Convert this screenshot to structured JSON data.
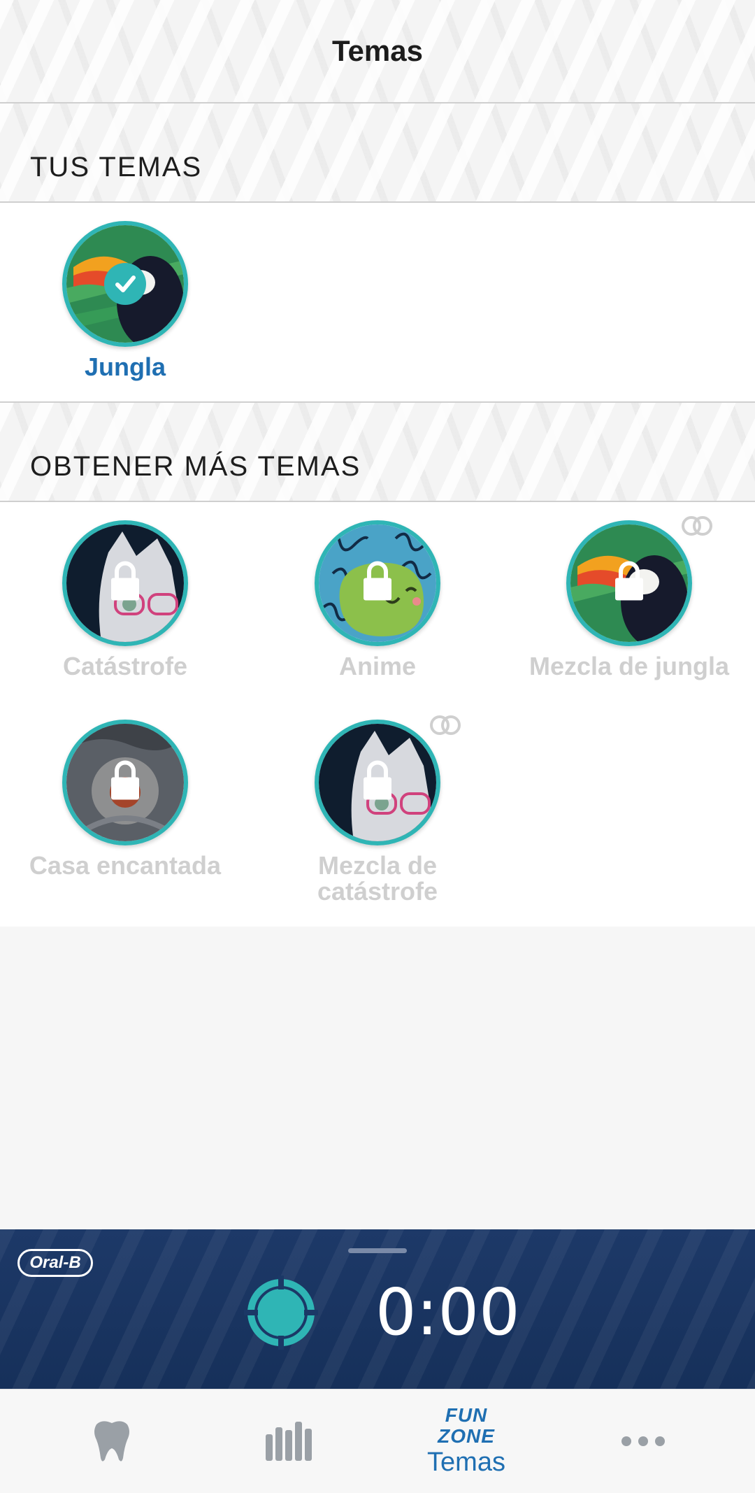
{
  "header": {
    "title": "Temas"
  },
  "your_themes": {
    "heading": "TUS TEMAS",
    "items": [
      {
        "name": "Jungla",
        "selected": true,
        "icon": "toucan-image"
      }
    ]
  },
  "more_themes": {
    "heading": "OBTENER MÁS TEMAS",
    "items": [
      {
        "name": "Catástrofe",
        "locked": true,
        "icon": "cat-image"
      },
      {
        "name": "Anime",
        "locked": true,
        "icon": "anime-blob-image"
      },
      {
        "name": "Mezcla de jungla",
        "locked": true,
        "icon": "toucan-image",
        "coins_badge": true
      },
      {
        "name": "Casa encantada",
        "locked": true,
        "icon": "eye-image"
      },
      {
        "name": "Mezcla de catástrofe",
        "name_line1": "Mezcla de",
        "name_line2": "catástrofe",
        "locked": true,
        "icon": "cat-image",
        "coins_badge": true
      }
    ]
  },
  "player": {
    "brand": "Oral-B",
    "timer": "0:00"
  },
  "tabbar": {
    "tabs": [
      {
        "id": "tooth",
        "icon": "tooth-icon"
      },
      {
        "id": "stats",
        "icon": "bar-chart-icon"
      },
      {
        "id": "themes",
        "badge_line1": "FUN",
        "badge_line2": "ZONE",
        "label": "Temas",
        "active": true
      },
      {
        "id": "more",
        "icon": "more-icon"
      }
    ]
  },
  "colors": {
    "accent": "#2fb5b5",
    "brand_blue": "#1f6fb2",
    "player_bg": "#1b3866",
    "locked_text": "#cfcfcf"
  }
}
